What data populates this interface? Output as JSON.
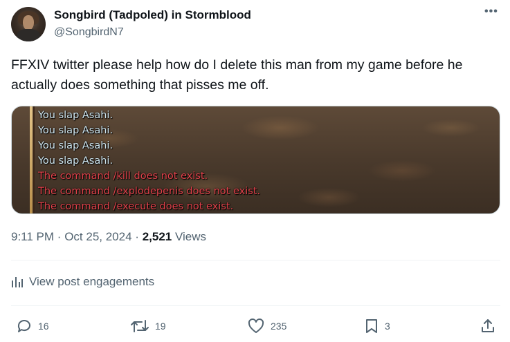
{
  "author": {
    "display_name": "Songbird (Tadpoled) in Stormblood",
    "handle": "@SongbirdN7",
    "avatar_icon": "user-avatar"
  },
  "tweet": {
    "text": "FFXIV twitter please help how do I delete this man from my game before he actually does something that pisses me off."
  },
  "media": {
    "chat_lines": [
      {
        "text": "You slap Asahi.",
        "type": "emote"
      },
      {
        "text": "You slap Asahi.",
        "type": "emote"
      },
      {
        "text": "You slap Asahi.",
        "type": "emote"
      },
      {
        "text": "You slap Asahi.",
        "type": "emote"
      },
      {
        "text": "The command /kill does not exist.",
        "type": "error"
      },
      {
        "text": "The command /explodepenis does not exist.",
        "type": "error"
      },
      {
        "text": "The command /execute does not exist.",
        "type": "error"
      }
    ],
    "colors": {
      "emote": "#cfe6f0",
      "error": "#e0414a"
    }
  },
  "meta": {
    "time": "9:11 PM",
    "separator": "·",
    "date": "Oct 25, 2024",
    "views_count": "2,521",
    "views_label": "Views"
  },
  "engagements": {
    "label": "View post engagements",
    "icon": "analytics-icon"
  },
  "actions": {
    "reply_count": "16",
    "retweet_count": "19",
    "like_count": "235",
    "bookmark_count": "3"
  },
  "colors": {
    "text_primary": "#0f1419",
    "text_secondary": "#536471",
    "divider": "#eff3f4"
  }
}
